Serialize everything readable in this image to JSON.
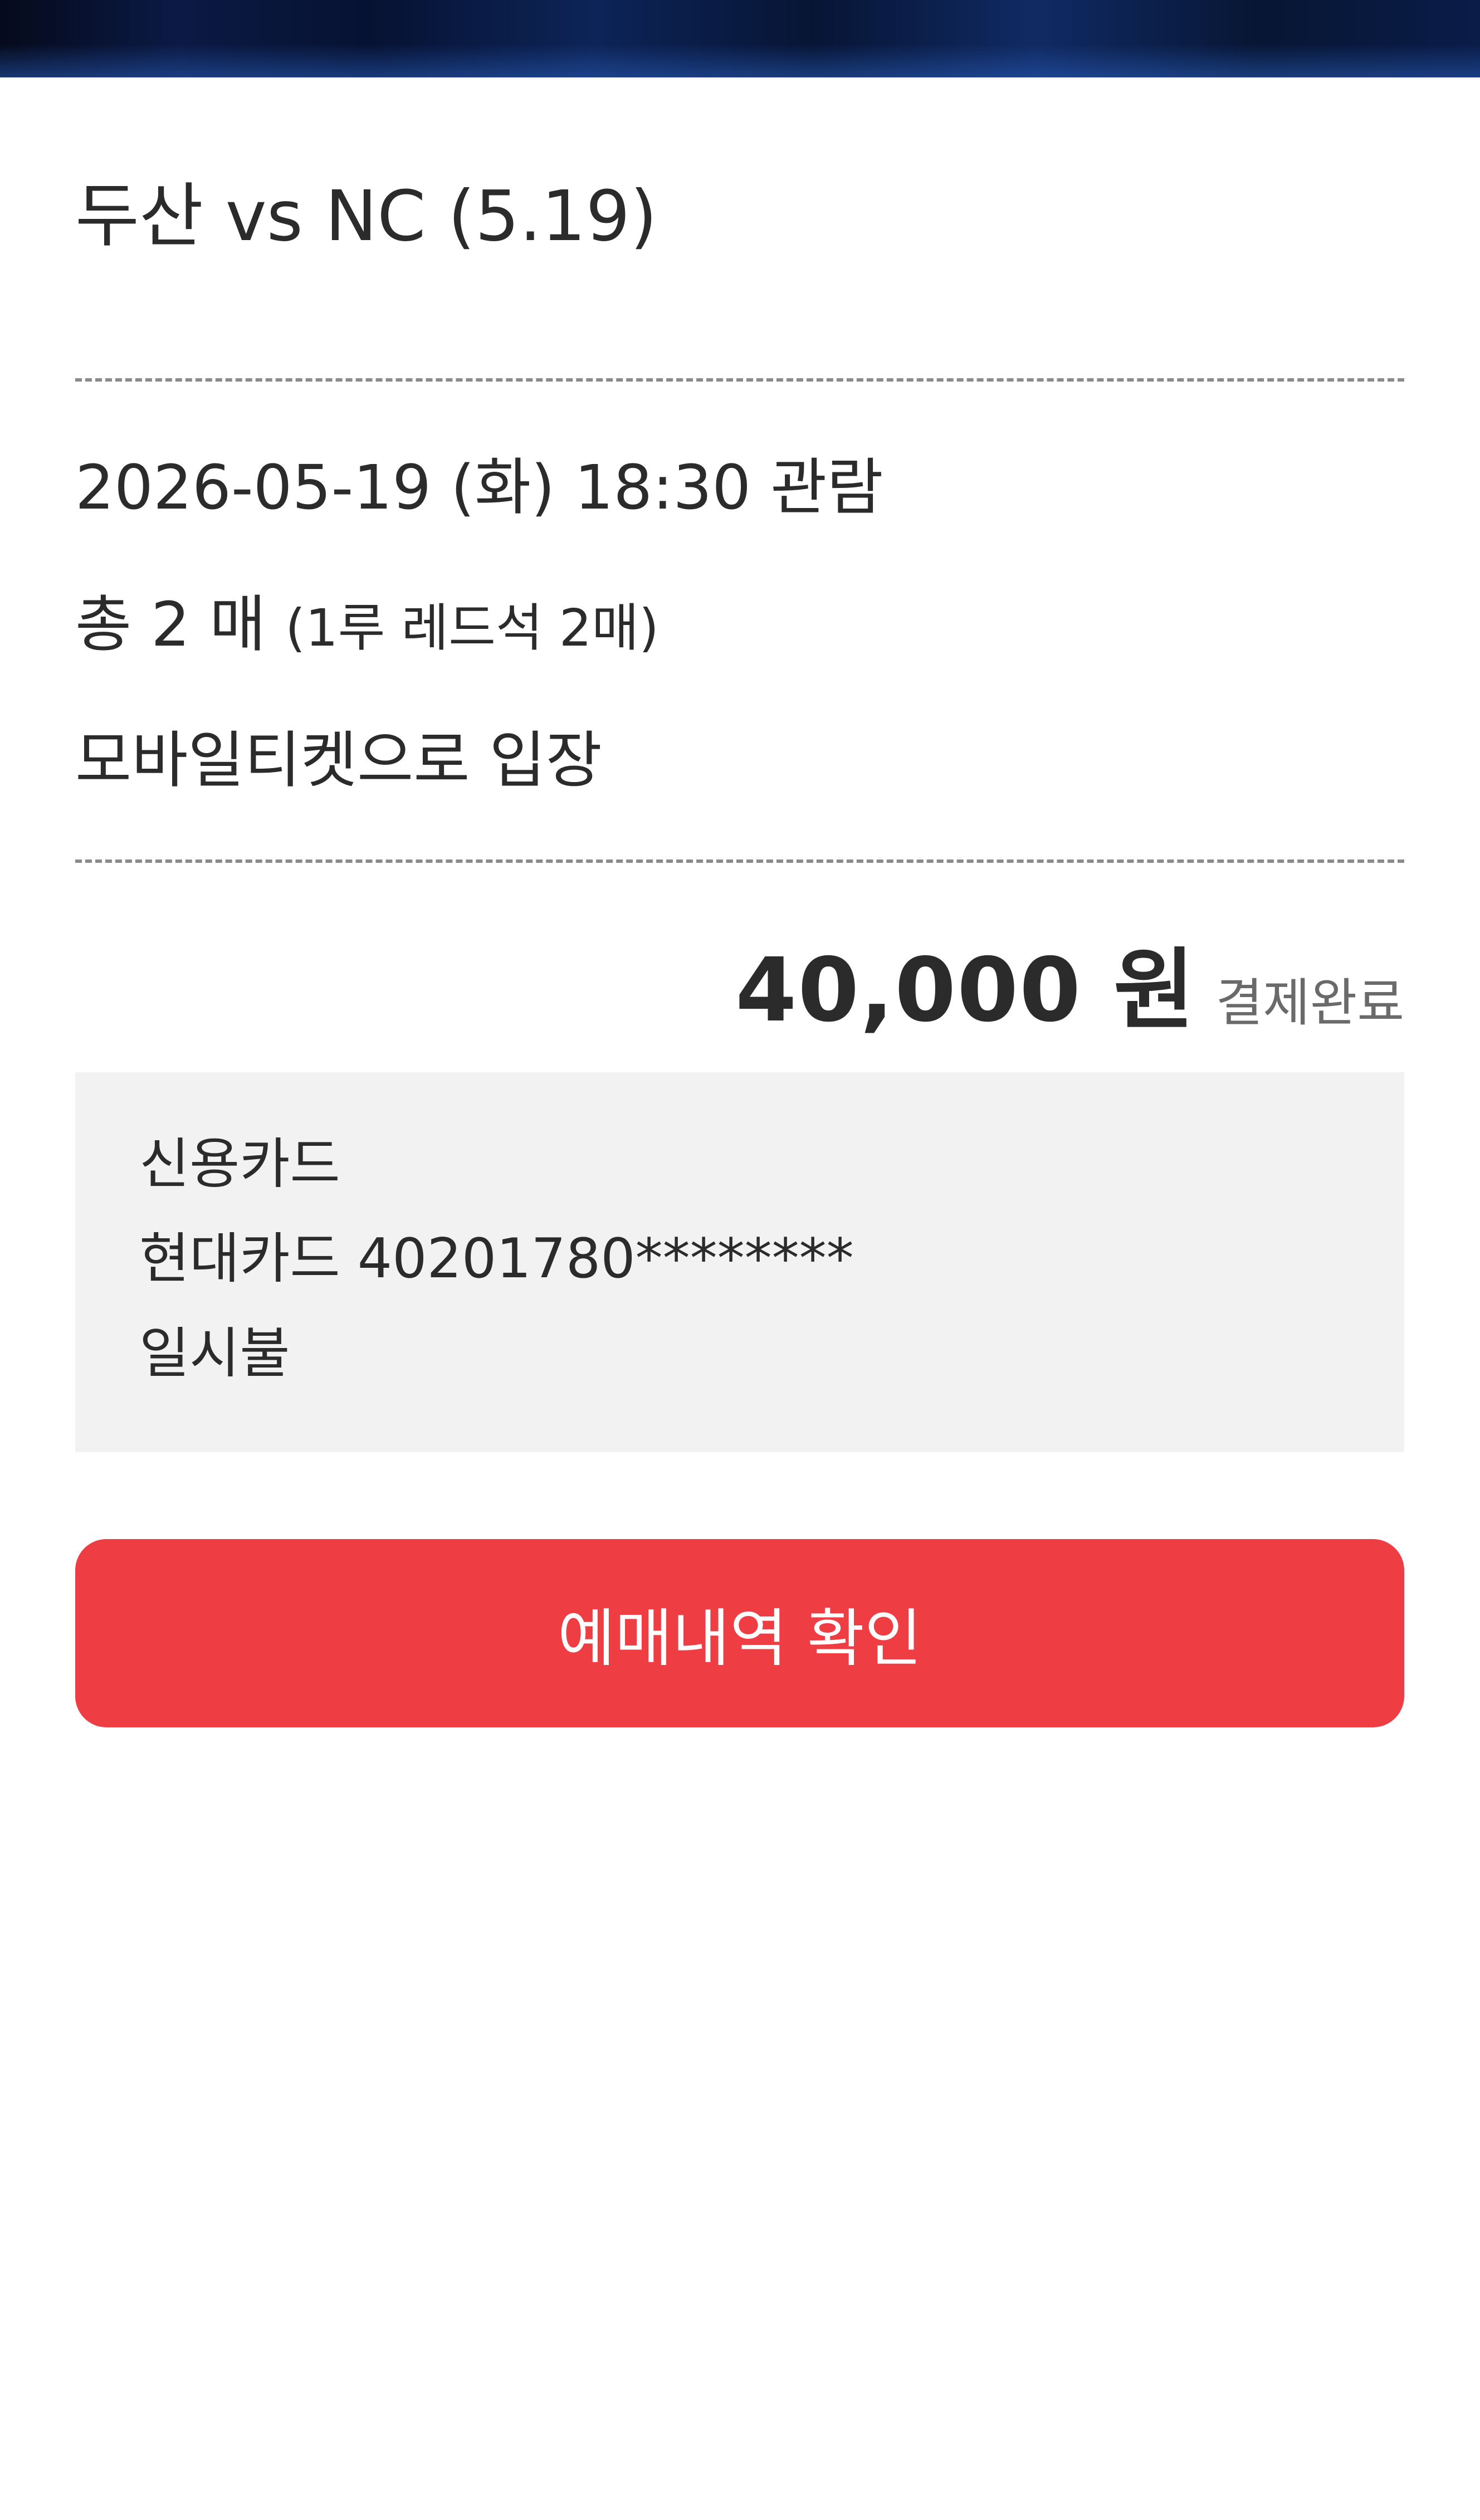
{
  "game": {
    "title": "두산 vs NC (5.19)"
  },
  "details": {
    "date_time": "2026-05-19 (화) 18:30 관람",
    "count_main": "총 2 매",
    "count_detail": "(1루 레드석 2매)",
    "entry_method": "모바일티켓으로 입장"
  },
  "price": {
    "amount": "40,000 원",
    "status": "결제완료"
  },
  "payment": {
    "method": "신용카드",
    "card": "현대카드 40201780********",
    "installment": "일시불"
  },
  "actions": {
    "confirm_label": "예매내역 확인"
  },
  "colors": {
    "accent_button": "#ef3d44",
    "payment_box_bg": "#f2f2f2",
    "banner_dark": "#0b1a44"
  }
}
